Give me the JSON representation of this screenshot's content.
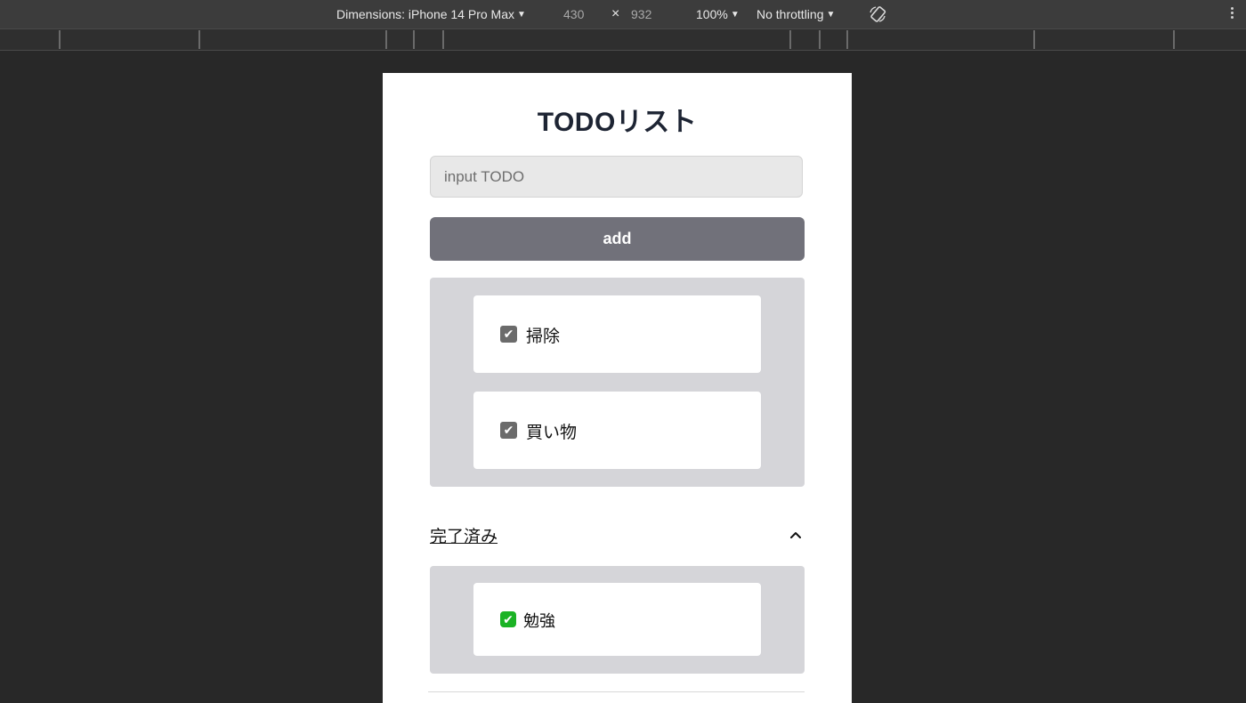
{
  "devtools": {
    "dimensions_label": "Dimensions: iPhone 14 Pro Max",
    "width": "430",
    "times": "×",
    "height": "932",
    "zoom": "100%",
    "throttling": "No throttling",
    "caret": "▼"
  },
  "app": {
    "title": "TODOリスト",
    "input_placeholder": "input TODO",
    "add_label": "add",
    "todos": [
      {
        "label": "掃除",
        "checked": true
      },
      {
        "label": "買い物",
        "checked": true
      }
    ],
    "completed_section": {
      "label": "完了済み",
      "expanded": true,
      "items": [
        {
          "label": "勉強",
          "done": true
        }
      ]
    }
  },
  "colors": {
    "add_button": "#71717a",
    "panel": "#d5d5d9",
    "done_check": "#1bb325"
  },
  "icons": {
    "checkbox": "✔",
    "done": "✔"
  }
}
